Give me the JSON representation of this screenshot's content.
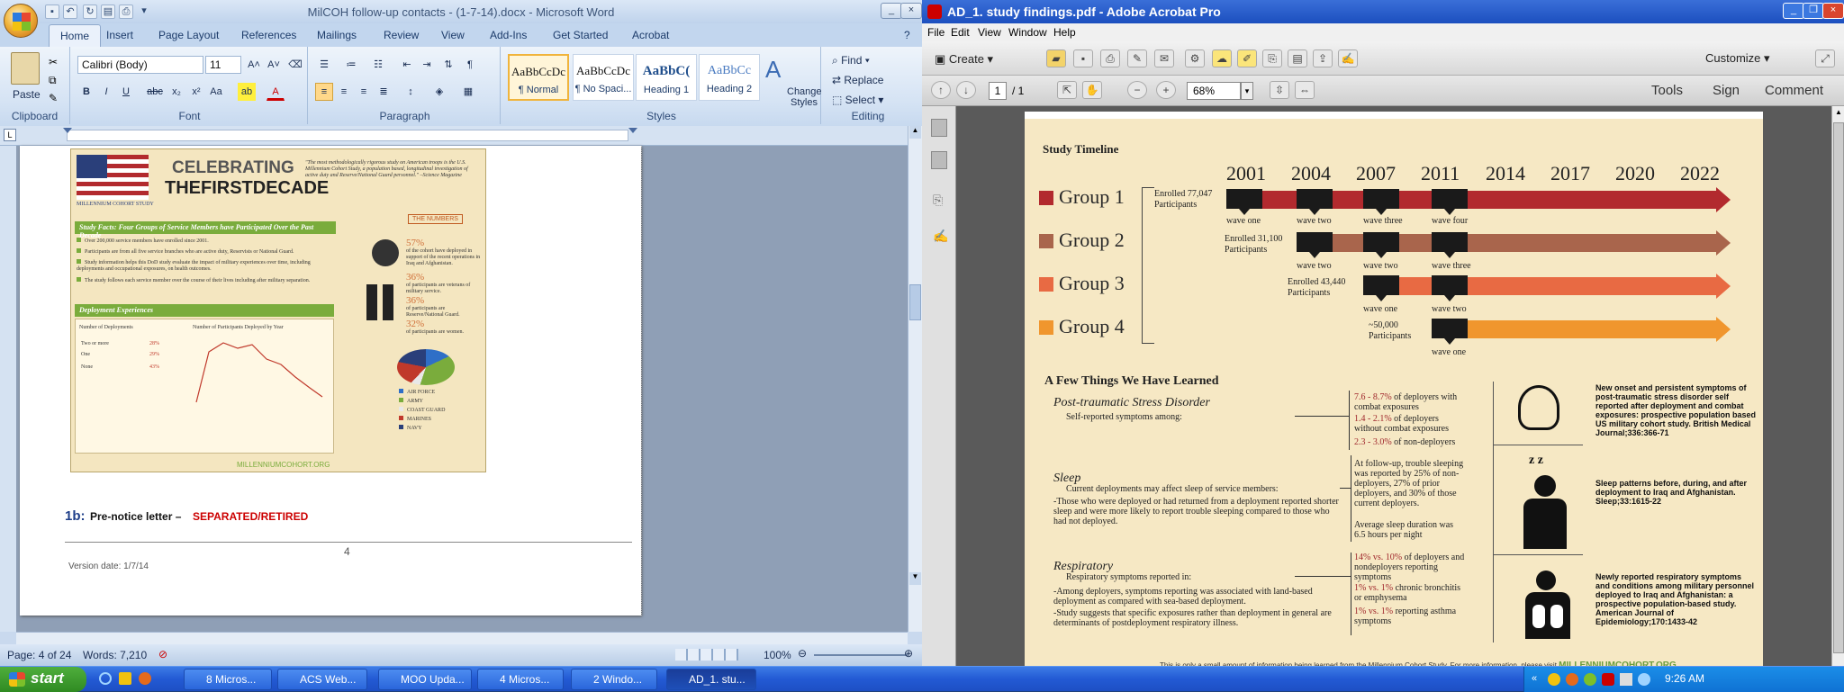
{
  "word": {
    "title": "MilCOH follow-up contacts - (1-7-14).docx - Microsoft Word",
    "tabs": [
      "Home",
      "Insert",
      "Page Layout",
      "References",
      "Mailings",
      "Review",
      "View",
      "Add-Ins",
      "Get Started",
      "Acrobat"
    ],
    "clipboard": {
      "paste": "Paste",
      "label": "Clipboard"
    },
    "font": {
      "name": "Calibri (Body)",
      "size": "11",
      "label": "Font"
    },
    "paragraph_label": "Paragraph",
    "styles": [
      {
        "preview": "AaBbCcDc",
        "name": "¶ Normal"
      },
      {
        "preview": "AaBbCcDc",
        "name": "¶ No Spaci..."
      },
      {
        "preview": "AaBbC(",
        "name": "Heading 1"
      },
      {
        "preview": "AaBbCc",
        "name": "Heading 2"
      }
    ],
    "styles_label": "Styles",
    "change_styles": "Change Styles",
    "editing": {
      "find": "Find",
      "replace": "Replace",
      "select": "Select",
      "label": "Editing"
    },
    "doc": {
      "flyer": {
        "celebrating": "CELEBRATING",
        "first_decade": "THEFIRSTDECADE",
        "cohort": "MILLENNIUM COHORT STUDY",
        "quote": "\"The most methodologically rigorous study on American troops is the U.S. Millennium Cohort Study, a population based, longitudinal investigation of active duty and Reserve/National Guard personnel.\" –Science Magazine",
        "facts_title": "Study Facts",
        "facts_sub": "Four Groups of Service Members have Participated Over the Past Decade",
        "facts": [
          "Over 200,000 service members have enrolled since 2001.",
          "Participants are from all five service branches who are active duty, Reservists or National Guard.",
          "Study information helps this DoD study evaluate the impact of military experiences over time, including deployments and occupational exposures, on health outcomes.",
          "The study follows each service member over the course of their lives including after military separation."
        ],
        "numbers_title": "THE NUMBERS",
        "numbers": [
          {
            "v": "57%",
            "t": "of the cohort have deployed in support of the recent operations in Iraq and Afghanistan."
          },
          {
            "v": "36%",
            "t": "of participants are veterans of military service."
          },
          {
            "v": "36%",
            "t": "of participants are Reserve/National Guard."
          },
          {
            "v": "32%",
            "t": "of participants are women."
          }
        ],
        "deploy_title": "Deployment Experiences",
        "deploy_table_head": "Number of Deployments",
        "deploy_rows": [
          {
            "k": "Two or more",
            "v": "28%"
          },
          {
            "k": "One",
            "v": "29%"
          },
          {
            "k": "None",
            "v": "43%"
          }
        ],
        "chart_title": "Number of Participants Deployed by Year",
        "legend": [
          "AIR FORCE",
          "ARMY",
          "COAST GUARD",
          "MARINES",
          "NAVY"
        ],
        "site": "MILLENNIUMCOHORT.ORG"
      },
      "prenotice_num": "1b:",
      "prenotice": "Pre-notice letter –",
      "prenotice_red": "SEPARATED/RETIRED",
      "page_number": "4",
      "version": "Version date: 1/7/14"
    },
    "status": {
      "page": "Page: 4 of 24",
      "words": "Words: 7,210",
      "zoom": "100%"
    }
  },
  "acrobat": {
    "title": "AD_1. study findings.pdf - Adobe Acrobat Pro",
    "menu": [
      "File",
      "Edit",
      "View",
      "Window",
      "Help"
    ],
    "create": "Create",
    "customize": "Customize",
    "page_current": "1",
    "page_total": "/ 1",
    "zoom": "68%",
    "panels": [
      "Tools",
      "Sign",
      "Comment"
    ],
    "pdf": {
      "timeline_title": "Study Timeline",
      "years": [
        "2001",
        "2004",
        "2007",
        "2011",
        "2014",
        "2017",
        "2020",
        "2022"
      ],
      "groups": [
        {
          "name": "Group 1",
          "color": "#b22a2e",
          "enrolled": "Enrolled 77,047 Participants",
          "waves": [
            "wave one",
            "wave two",
            "wave three",
            "wave four"
          ]
        },
        {
          "name": "Group 2",
          "color": "#a9654c",
          "enrolled": "Enrolled 31,100 Participants",
          "waves": [
            "wave two",
            "wave three"
          ]
        },
        {
          "name": "Group 3",
          "color": "#e86a43",
          "enrolled": "Enrolled 43,440 Participants",
          "waves": [
            "wave one",
            "wave two"
          ]
        },
        {
          "name": "Group 4",
          "color": "#f0962e",
          "enrolled": "~50,000 Participants",
          "waves": [
            "wave one"
          ]
        }
      ],
      "learned_title": "A Few Things We Have Learned",
      "ptsd": {
        "title": "Post-traumatic Stress Disorder",
        "sub": "Self-reported symptoms among:",
        "stats": [
          {
            "v": "7.6 - 8.7%",
            "t": "of deployers with combat exposures"
          },
          {
            "v": "1.4 - 2.1%",
            "t": "of deployers without combat exposures"
          },
          {
            "v": "2.3 - 3.0%",
            "t": "of non-deployers"
          }
        ],
        "ref": "New onset and persistent symptoms of post-traumatic stress disorder self reported after deployment and combat exposures: prospective population based US military cohort study. British Medical Journal;336:366-71"
      },
      "sleep": {
        "title": "Sleep",
        "sub": "Current deployments may affect sleep of service members:",
        "body": "-Those who were deployed or had returned from a deployment reported shorter sleep and were more likely to report trouble sleeping compared to those who had not deployed.",
        "stats1": "At follow-up, trouble sleeping was reported by 25% of non-deployers, 27% of prior deployers, and 30% of those current deployers.",
        "stats2": "Average sleep duration was 6.5 hours per night",
        "ref": "Sleep patterns before, during, and after deployment to Iraq and Afghanistan. Sleep;33:1615-22"
      },
      "resp": {
        "title": "Respiratory",
        "sub": "Respiratory symptoms reported in:",
        "body1": "-Among deployers, symptoms reporting was associated with land-based deployment as compared with sea-based deployment.",
        "body2": "-Study suggests that specific exposures rather than deployment in general are determinants of postdeployment respiratory illness.",
        "stats": [
          {
            "v": "14% vs. 10%",
            "t": "of deployers and nondeployers reporting symptoms"
          },
          {
            "v": "1% vs. 1%",
            "t": "chronic bronchitis or emphysema"
          },
          {
            "v": "1% vs. 1%",
            "t": "reporting asthma symptoms"
          }
        ],
        "ref": "Newly reported respiratory symptoms and conditions among military personnel deployed to Iraq and Afghanistan: a prospective population-based study. American Journal of Epidemiology;170:1433-42"
      },
      "footer": "This is only a small amount of information being learned from the Millennium Cohort Study.  For more information, please visit",
      "footer_link": "MILLENNIUMCOHORT.ORG"
    }
  },
  "taskbar": {
    "start": "start",
    "tasks": [
      "8 Micros...",
      "ACS Web...",
      "MOO Upda...",
      "4 Micros...",
      "2 Windo...",
      "AD_1. stu..."
    ],
    "clock": "9:26 AM"
  }
}
